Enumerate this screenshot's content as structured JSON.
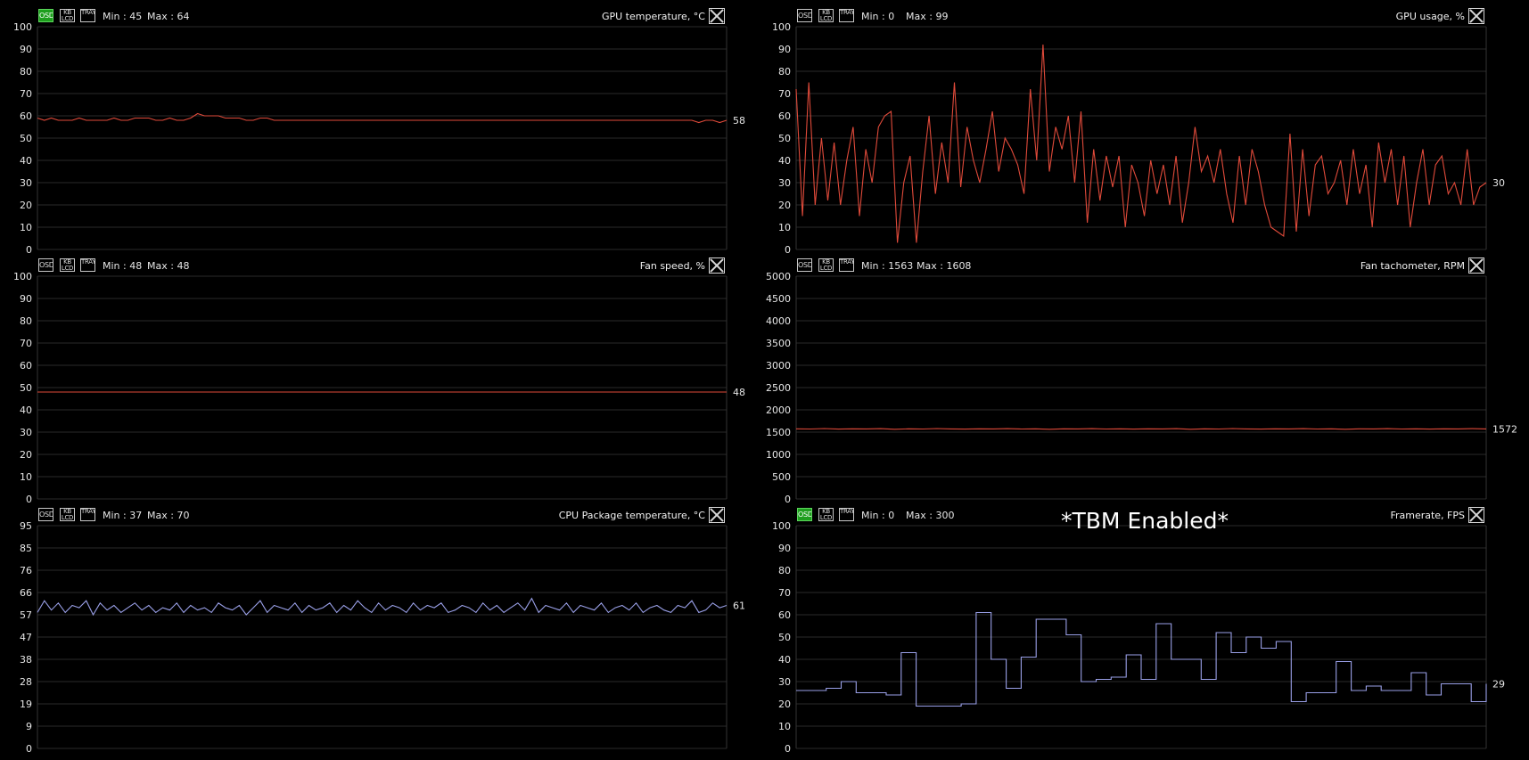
{
  "buttons": {
    "osd": "OSD",
    "lcd": "KB LCD",
    "tray": "TRAY"
  },
  "annotation": "*TBM Enabled*",
  "colors": {
    "red": "#e04a3a",
    "blue": "#9aa0e8",
    "grid": "#2a2a2a",
    "osd_on": "#1e9e1e"
  },
  "panels": [
    {
      "id": "gpu-temp",
      "title": "GPU temperature, °C",
      "min_text": "Min : 45",
      "max_text": "Max : 64",
      "current": "58",
      "osd_on": true,
      "color": "red",
      "y_ticks": [
        "100",
        "90",
        "80",
        "70",
        "60",
        "50",
        "40",
        "30",
        "20",
        "10",
        "0"
      ],
      "ymin": 0,
      "ymax": 100
    },
    {
      "id": "gpu-usage",
      "title": "GPU usage, %",
      "min_text": "Min : 0",
      "max_text": "Max : 99",
      "current": "30",
      "osd_on": false,
      "color": "red",
      "y_ticks": [
        "100",
        "90",
        "80",
        "70",
        "60",
        "50",
        "40",
        "30",
        "20",
        "10",
        "0"
      ],
      "ymin": 0,
      "ymax": 100
    },
    {
      "id": "fan-speed",
      "title": "Fan speed, %",
      "min_text": "Min : 48",
      "max_text": "Max : 48",
      "current": "48",
      "osd_on": false,
      "color": "red",
      "y_ticks": [
        "100",
        "90",
        "80",
        "70",
        "60",
        "50",
        "40",
        "30",
        "20",
        "10",
        "0"
      ],
      "ymin": 0,
      "ymax": 100
    },
    {
      "id": "fan-tach",
      "title": "Fan tachometer, RPM",
      "min_text": "Min : 1563",
      "max_text": "Max : 1608",
      "current": "1572",
      "osd_on": false,
      "color": "red",
      "y_ticks": [
        "5000",
        "4500",
        "4000",
        "3500",
        "3000",
        "2500",
        "2000",
        "1500",
        "1000",
        "500",
        "0"
      ],
      "ymin": 0,
      "ymax": 5000
    },
    {
      "id": "cpu-temp",
      "title": "CPU Package temperature, °C",
      "min_text": "Min : 37",
      "max_text": "Max : 70",
      "current": "61",
      "osd_on": false,
      "color": "blue",
      "y_ticks": [
        "95",
        "85",
        "76",
        "66",
        "57",
        "47",
        "38",
        "28",
        "19",
        "9",
        "0"
      ],
      "ymin": 0,
      "ymax": 95
    },
    {
      "id": "framerate",
      "title": "Framerate, FPS",
      "min_text": "Min : 0",
      "max_text": "Max : 300",
      "current": "29",
      "osd_on": true,
      "color": "blue",
      "y_ticks": [
        "100",
        "90",
        "80",
        "70",
        "60",
        "50",
        "40",
        "30",
        "20",
        "10",
        "0"
      ],
      "ymin": 0,
      "ymax": 100
    }
  ],
  "chart_data": [
    {
      "type": "line",
      "title": "GPU temperature, °C",
      "ylim": [
        0,
        100
      ],
      "series": [
        {
          "values": [
            59,
            58,
            59,
            58,
            58,
            58,
            59,
            58,
            58,
            58,
            58,
            59,
            58,
            58,
            59,
            59,
            59,
            58,
            58,
            59,
            58,
            58,
            59,
            61,
            60,
            60,
            60,
            59,
            59,
            59,
            58,
            58,
            59,
            59,
            58,
            58,
            58,
            58,
            58,
            58,
            58,
            58,
            58,
            58,
            58,
            58,
            58,
            58,
            58,
            58,
            58,
            58,
            58,
            58,
            58,
            58,
            58,
            58,
            58,
            58,
            58,
            58,
            58,
            58,
            58,
            58,
            58,
            58,
            58,
            58,
            58,
            58,
            58,
            58,
            58,
            58,
            58,
            58,
            58,
            58,
            58,
            58,
            58,
            58,
            58,
            58,
            58,
            58,
            58,
            58,
            58,
            58,
            58,
            58,
            58,
            57,
            58,
            58,
            57,
            58
          ]
        }
      ]
    },
    {
      "type": "line",
      "title": "GPU usage, %",
      "ylim": [
        0,
        100
      ],
      "series": [
        {
          "values": [
            72,
            15,
            75,
            20,
            50,
            22,
            48,
            20,
            40,
            55,
            15,
            45,
            30,
            55,
            60,
            62,
            3,
            30,
            42,
            3,
            35,
            60,
            25,
            48,
            30,
            75,
            28,
            55,
            40,
            30,
            45,
            62,
            35,
            50,
            45,
            38,
            25,
            72,
            40,
            92,
            35,
            55,
            45,
            60,
            30,
            62,
            12,
            45,
            22,
            42,
            28,
            42,
            10,
            38,
            30,
            15,
            40,
            25,
            38,
            20,
            42,
            12,
            30,
            55,
            35,
            42,
            30,
            45,
            25,
            12,
            42,
            20,
            45,
            35,
            20,
            10,
            8,
            6,
            52,
            8,
            45,
            15,
            38,
            42,
            25,
            30,
            40,
            20,
            45,
            25,
            38,
            10,
            48,
            30,
            45,
            20,
            42,
            10,
            30,
            45,
            20,
            38,
            42,
            25,
            30,
            20,
            45,
            20,
            28,
            30
          ]
        }
      ]
    },
    {
      "type": "line",
      "title": "Fan speed, %",
      "ylim": [
        0,
        100
      ],
      "series": [
        {
          "values": [
            48,
            48,
            48,
            48,
            48,
            48,
            48,
            48,
            48,
            48,
            48,
            48,
            48,
            48,
            48,
            48,
            48,
            48,
            48,
            48,
            48,
            48,
            48,
            48,
            48,
            48,
            48,
            48,
            48,
            48,
            48,
            48,
            48,
            48,
            48,
            48,
            48,
            48,
            48,
            48,
            48,
            48,
            48,
            48,
            48,
            48,
            48,
            48,
            48,
            48
          ]
        }
      ]
    },
    {
      "type": "line",
      "title": "Fan tachometer, RPM",
      "ylim": [
        0,
        5000
      ],
      "series": [
        {
          "values": [
            1575,
            1570,
            1580,
            1568,
            1575,
            1572,
            1578,
            1565,
            1575,
            1570,
            1580,
            1572,
            1568,
            1575,
            1572,
            1578,
            1570,
            1575,
            1565,
            1575,
            1572,
            1578,
            1570,
            1575,
            1568,
            1575,
            1572,
            1578,
            1565,
            1575,
            1570,
            1580,
            1572,
            1568,
            1575,
            1572,
            1578,
            1570,
            1575,
            1565,
            1575,
            1572,
            1578,
            1570,
            1575,
            1568,
            1575,
            1572,
            1578,
            1572
          ]
        }
      ]
    },
    {
      "type": "line",
      "title": "CPU Package temperature, °C",
      "ylim": [
        0,
        95
      ],
      "series": [
        {
          "values": [
            58,
            63,
            59,
            62,
            58,
            61,
            60,
            63,
            57,
            62,
            59,
            61,
            58,
            60,
            62,
            59,
            61,
            58,
            60,
            59,
            62,
            58,
            61,
            59,
            60,
            58,
            62,
            60,
            59,
            61,
            57,
            60,
            63,
            58,
            61,
            60,
            59,
            62,
            58,
            61,
            59,
            60,
            62,
            58,
            61,
            59,
            63,
            60,
            58,
            62,
            59,
            61,
            60,
            58,
            62,
            59,
            61,
            60,
            62,
            58,
            59,
            61,
            60,
            58,
            62,
            59,
            61,
            58,
            60,
            62,
            59,
            64,
            58,
            61,
            60,
            59,
            62,
            58,
            61,
            60,
            59,
            62,
            58,
            60,
            61,
            59,
            62,
            58,
            60,
            61,
            59,
            58,
            61,
            60,
            63,
            58,
            59,
            62,
            60,
            61
          ]
        }
      ]
    },
    {
      "type": "line",
      "title": "Framerate, FPS",
      "ylim": [
        0,
        100
      ],
      "series": [
        {
          "values": [
            26,
            26,
            27,
            30,
            25,
            25,
            24,
            43,
            19,
            19,
            19,
            20,
            61,
            40,
            27,
            41,
            58,
            58,
            51,
            30,
            31,
            32,
            42,
            31,
            56,
            40,
            40,
            31,
            52,
            43,
            50,
            45,
            48,
            21,
            25,
            25,
            39,
            26,
            28,
            26,
            26,
            34,
            24,
            29,
            29,
            21,
            29
          ]
        }
      ]
    }
  ]
}
